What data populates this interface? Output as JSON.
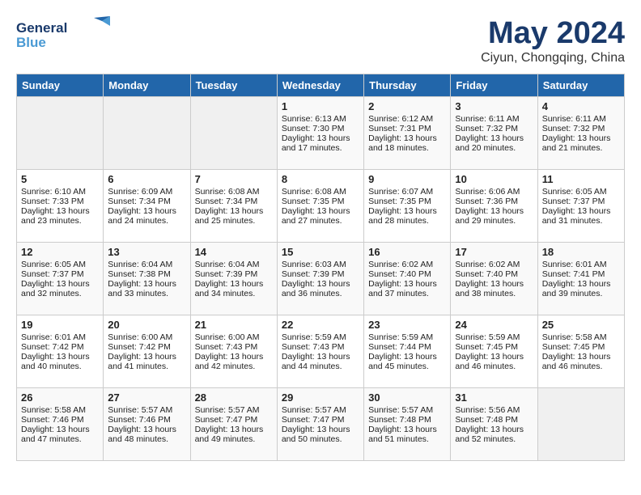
{
  "header": {
    "logo_general": "General",
    "logo_blue": "Blue",
    "month_year": "May 2024",
    "location": "Ciyun, Chongqing, China"
  },
  "days_of_week": [
    "Sunday",
    "Monday",
    "Tuesday",
    "Wednesday",
    "Thursday",
    "Friday",
    "Saturday"
  ],
  "weeks": [
    [
      {
        "day": "",
        "empty": true
      },
      {
        "day": "",
        "empty": true
      },
      {
        "day": "",
        "empty": true
      },
      {
        "day": "1",
        "sunrise": "6:13 AM",
        "sunset": "7:30 PM",
        "daylight": "13 hours and 17 minutes."
      },
      {
        "day": "2",
        "sunrise": "6:12 AM",
        "sunset": "7:31 PM",
        "daylight": "13 hours and 18 minutes."
      },
      {
        "day": "3",
        "sunrise": "6:11 AM",
        "sunset": "7:32 PM",
        "daylight": "13 hours and 20 minutes."
      },
      {
        "day": "4",
        "sunrise": "6:11 AM",
        "sunset": "7:32 PM",
        "daylight": "13 hours and 21 minutes."
      }
    ],
    [
      {
        "day": "5",
        "sunrise": "6:10 AM",
        "sunset": "7:33 PM",
        "daylight": "13 hours and 23 minutes."
      },
      {
        "day": "6",
        "sunrise": "6:09 AM",
        "sunset": "7:34 PM",
        "daylight": "13 hours and 24 minutes."
      },
      {
        "day": "7",
        "sunrise": "6:08 AM",
        "sunset": "7:34 PM",
        "daylight": "13 hours and 25 minutes."
      },
      {
        "day": "8",
        "sunrise": "6:08 AM",
        "sunset": "7:35 PM",
        "daylight": "13 hours and 27 minutes."
      },
      {
        "day": "9",
        "sunrise": "6:07 AM",
        "sunset": "7:35 PM",
        "daylight": "13 hours and 28 minutes."
      },
      {
        "day": "10",
        "sunrise": "6:06 AM",
        "sunset": "7:36 PM",
        "daylight": "13 hours and 29 minutes."
      },
      {
        "day": "11",
        "sunrise": "6:05 AM",
        "sunset": "7:37 PM",
        "daylight": "13 hours and 31 minutes."
      }
    ],
    [
      {
        "day": "12",
        "sunrise": "6:05 AM",
        "sunset": "7:37 PM",
        "daylight": "13 hours and 32 minutes."
      },
      {
        "day": "13",
        "sunrise": "6:04 AM",
        "sunset": "7:38 PM",
        "daylight": "13 hours and 33 minutes."
      },
      {
        "day": "14",
        "sunrise": "6:04 AM",
        "sunset": "7:39 PM",
        "daylight": "13 hours and 34 minutes."
      },
      {
        "day": "15",
        "sunrise": "6:03 AM",
        "sunset": "7:39 PM",
        "daylight": "13 hours and 36 minutes."
      },
      {
        "day": "16",
        "sunrise": "6:02 AM",
        "sunset": "7:40 PM",
        "daylight": "13 hours and 37 minutes."
      },
      {
        "day": "17",
        "sunrise": "6:02 AM",
        "sunset": "7:40 PM",
        "daylight": "13 hours and 38 minutes."
      },
      {
        "day": "18",
        "sunrise": "6:01 AM",
        "sunset": "7:41 PM",
        "daylight": "13 hours and 39 minutes."
      }
    ],
    [
      {
        "day": "19",
        "sunrise": "6:01 AM",
        "sunset": "7:42 PM",
        "daylight": "13 hours and 40 minutes."
      },
      {
        "day": "20",
        "sunrise": "6:00 AM",
        "sunset": "7:42 PM",
        "daylight": "13 hours and 41 minutes."
      },
      {
        "day": "21",
        "sunrise": "6:00 AM",
        "sunset": "7:43 PM",
        "daylight": "13 hours and 42 minutes."
      },
      {
        "day": "22",
        "sunrise": "5:59 AM",
        "sunset": "7:43 PM",
        "daylight": "13 hours and 44 minutes."
      },
      {
        "day": "23",
        "sunrise": "5:59 AM",
        "sunset": "7:44 PM",
        "daylight": "13 hours and 45 minutes."
      },
      {
        "day": "24",
        "sunrise": "5:59 AM",
        "sunset": "7:45 PM",
        "daylight": "13 hours and 46 minutes."
      },
      {
        "day": "25",
        "sunrise": "5:58 AM",
        "sunset": "7:45 PM",
        "daylight": "13 hours and 46 minutes."
      }
    ],
    [
      {
        "day": "26",
        "sunrise": "5:58 AM",
        "sunset": "7:46 PM",
        "daylight": "13 hours and 47 minutes."
      },
      {
        "day": "27",
        "sunrise": "5:57 AM",
        "sunset": "7:46 PM",
        "daylight": "13 hours and 48 minutes."
      },
      {
        "day": "28",
        "sunrise": "5:57 AM",
        "sunset": "7:47 PM",
        "daylight": "13 hours and 49 minutes."
      },
      {
        "day": "29",
        "sunrise": "5:57 AM",
        "sunset": "7:47 PM",
        "daylight": "13 hours and 50 minutes."
      },
      {
        "day": "30",
        "sunrise": "5:57 AM",
        "sunset": "7:48 PM",
        "daylight": "13 hours and 51 minutes."
      },
      {
        "day": "31",
        "sunrise": "5:56 AM",
        "sunset": "7:48 PM",
        "daylight": "13 hours and 52 minutes."
      },
      {
        "day": "",
        "empty": true
      }
    ]
  ]
}
